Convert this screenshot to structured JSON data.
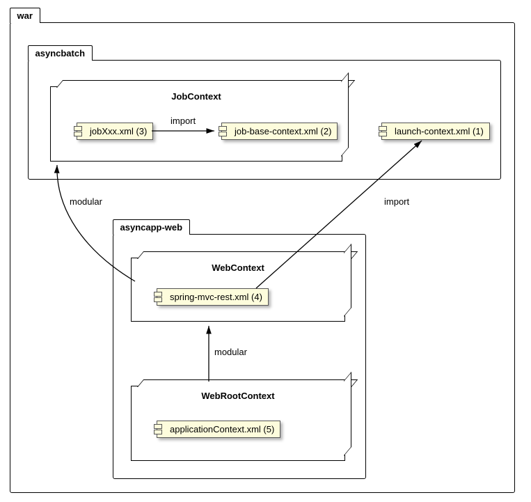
{
  "packages": {
    "war": {
      "label": "war"
    },
    "asyncbatch": {
      "label": "asyncbatch"
    },
    "asyncapp_web": {
      "label": "asyncapp-web"
    }
  },
  "nodes": {
    "job_context": {
      "title": "JobContext"
    },
    "web_context": {
      "title": "WebContext"
    },
    "web_root_context": {
      "title": "WebRootContext"
    }
  },
  "components": {
    "jobxxx": {
      "label": "jobXxx.xml (3)"
    },
    "job_base": {
      "label": "job-base-context.xml (2)"
    },
    "launch": {
      "label": "launch-context.xml (1)"
    },
    "spring_mvc": {
      "label": "spring-mvc-rest.xml (4)"
    },
    "app_context": {
      "label": "applicationContext.xml (5)"
    }
  },
  "edges": {
    "import1": {
      "label": "import"
    },
    "import2": {
      "label": "import"
    },
    "modular1": {
      "label": "modular"
    },
    "modular2": {
      "label": "modular"
    }
  }
}
